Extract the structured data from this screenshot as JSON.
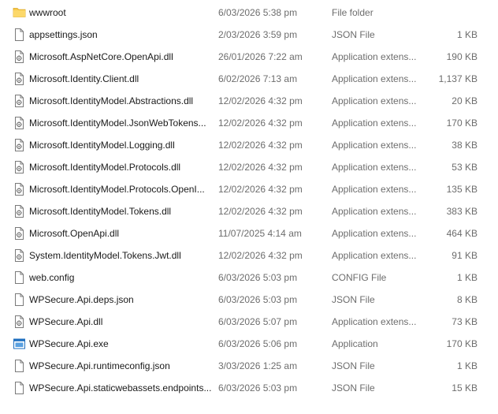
{
  "files": [
    {
      "name": "wwwroot",
      "date": "6/03/2026 5:38 pm",
      "type": "File folder",
      "size": "",
      "icon": "folder-icon"
    },
    {
      "name": "appsettings.json",
      "date": "2/03/2026 3:59 pm",
      "type": "JSON File",
      "size": "1 KB",
      "icon": "document-icon"
    },
    {
      "name": "Microsoft.AspNetCore.OpenApi.dll",
      "date": "26/01/2026 7:22 am",
      "type": "Application extens...",
      "size": "190 KB",
      "icon": "dll-icon"
    },
    {
      "name": "Microsoft.Identity.Client.dll",
      "date": "6/02/2026 7:13 am",
      "type": "Application extens...",
      "size": "1,137 KB",
      "icon": "dll-icon"
    },
    {
      "name": "Microsoft.IdentityModel.Abstractions.dll",
      "date": "12/02/2026 4:32 pm",
      "type": "Application extens...",
      "size": "20 KB",
      "icon": "dll-icon"
    },
    {
      "name": "Microsoft.IdentityModel.JsonWebTokens...",
      "date": "12/02/2026 4:32 pm",
      "type": "Application extens...",
      "size": "170 KB",
      "icon": "dll-icon"
    },
    {
      "name": "Microsoft.IdentityModel.Logging.dll",
      "date": "12/02/2026 4:32 pm",
      "type": "Application extens...",
      "size": "38 KB",
      "icon": "dll-icon"
    },
    {
      "name": "Microsoft.IdentityModel.Protocols.dll",
      "date": "12/02/2026 4:32 pm",
      "type": "Application extens...",
      "size": "53 KB",
      "icon": "dll-icon"
    },
    {
      "name": "Microsoft.IdentityModel.Protocols.OpenI...",
      "date": "12/02/2026 4:32 pm",
      "type": "Application extens...",
      "size": "135 KB",
      "icon": "dll-icon"
    },
    {
      "name": "Microsoft.IdentityModel.Tokens.dll",
      "date": "12/02/2026 4:32 pm",
      "type": "Application extens...",
      "size": "383 KB",
      "icon": "dll-icon"
    },
    {
      "name": "Microsoft.OpenApi.dll",
      "date": "11/07/2025 4:14 am",
      "type": "Application extens...",
      "size": "464 KB",
      "icon": "dll-icon"
    },
    {
      "name": "System.IdentityModel.Tokens.Jwt.dll",
      "date": "12/02/2026 4:32 pm",
      "type": "Application extens...",
      "size": "91 KB",
      "icon": "dll-icon"
    },
    {
      "name": "web.config",
      "date": "6/03/2026 5:03 pm",
      "type": "CONFIG File",
      "size": "1 KB",
      "icon": "document-icon"
    },
    {
      "name": "WPSecure.Api.deps.json",
      "date": "6/03/2026 5:03 pm",
      "type": "JSON File",
      "size": "8 KB",
      "icon": "document-icon"
    },
    {
      "name": "WPSecure.Api.dll",
      "date": "6/03/2026 5:07 pm",
      "type": "Application extens...",
      "size": "73 KB",
      "icon": "dll-icon"
    },
    {
      "name": "WPSecure.Api.exe",
      "date": "6/03/2026 5:06 pm",
      "type": "Application",
      "size": "170 KB",
      "icon": "exe-icon"
    },
    {
      "name": "WPSecure.Api.runtimeconfig.json",
      "date": "3/03/2026 1:25 am",
      "type": "JSON File",
      "size": "1 KB",
      "icon": "document-icon"
    },
    {
      "name": "WPSecure.Api.staticwebassets.endpoints....",
      "date": "6/03/2026 5:03 pm",
      "type": "JSON File",
      "size": "15 KB",
      "icon": "document-icon"
    }
  ],
  "colors": {
    "text": "#1a1a1a",
    "secondary_text": "#6d6d6d",
    "folder": "#f8c94a",
    "exe_accent": "#1f6fbf"
  }
}
